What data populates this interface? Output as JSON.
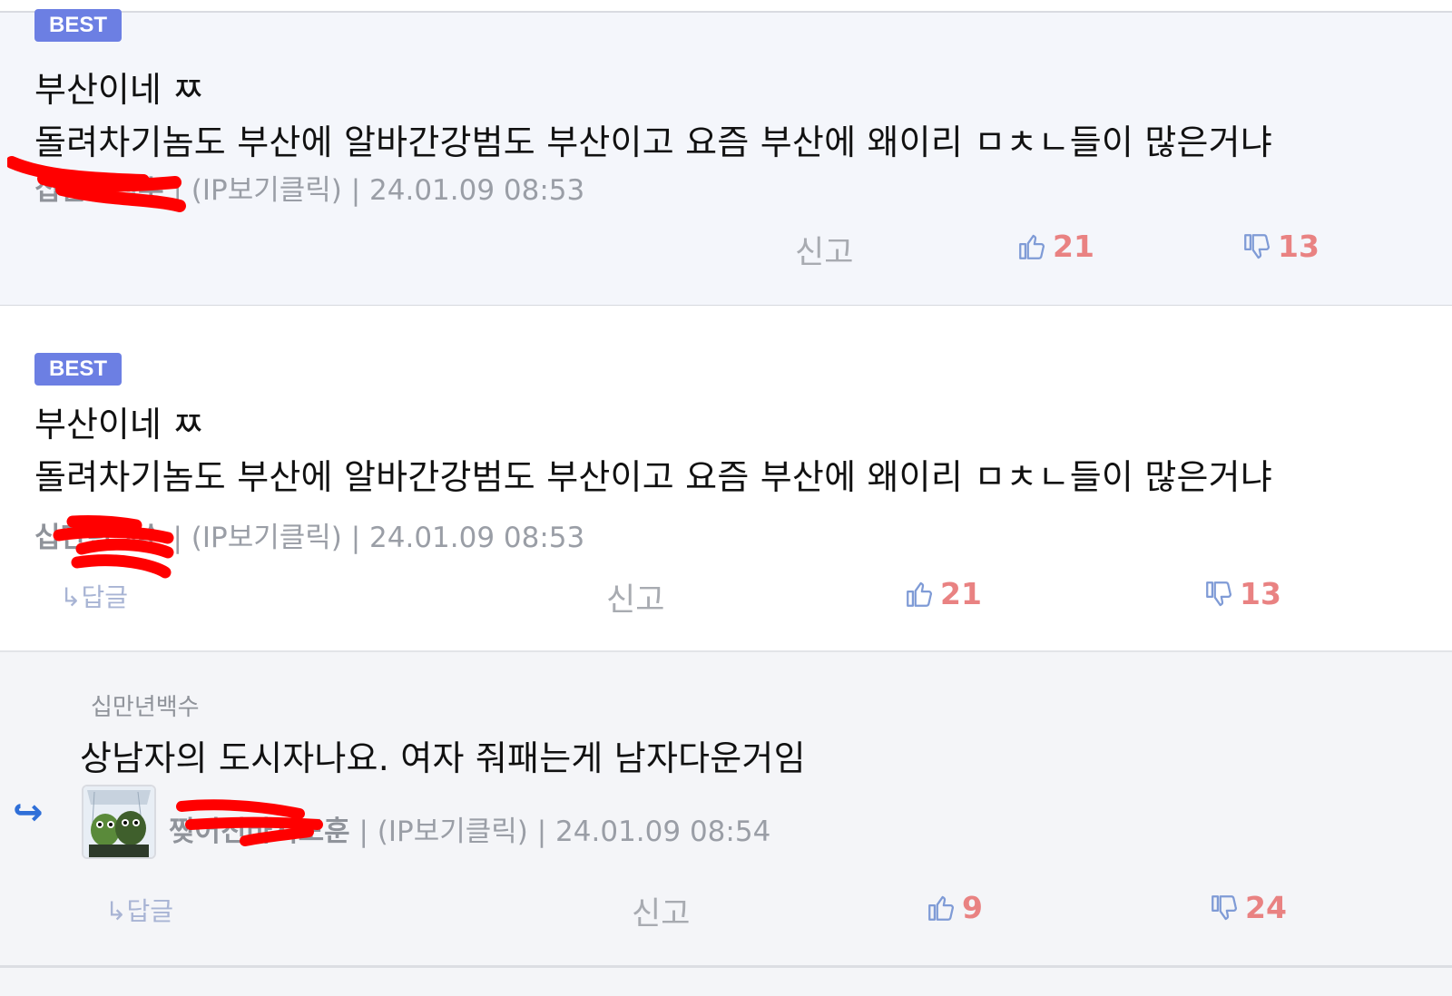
{
  "comments": [
    {
      "badge": "BEST",
      "title": "부산이네 ㅉ",
      "body": "돌려차기놈도 부산에 알바간강범도 부산이고 요즘 부산에 왜이리 ㅁㅊㄴ들이 많은거냐",
      "user": "십만년백수",
      "meta": " | (IP보기클릭) | 24.01.09 08:53",
      "report": "신고",
      "likes": "21",
      "dislikes": "13"
    },
    {
      "badge": "BEST",
      "title": "부산이네 ㅉ",
      "body": "돌려차기놈도 부산에 알바간강범도 부산이고 요즘 부산에 왜이리 ㅁㅊㄴ들이 많은거냐",
      "user": "십만년백수",
      "meta": " | (IP보기클릭) | 24.01.09 08:53",
      "reply": "↳답글",
      "report": "신고",
      "likes": "21",
      "dislikes": "13"
    }
  ],
  "reply_comment": {
    "reply_to": "십만년백수",
    "body": "상남자의 도시자나요. 여자 줘패는게 남자다운거임",
    "user": "찢어진바지도훈",
    "meta": " | (IP보기클릭) | 24.01.09 08:54",
    "reply": "↳답글",
    "report": "신고",
    "likes": "9",
    "dislikes": "24",
    "arrow": "↪"
  },
  "colors": {
    "badge": "#6c7fe3",
    "vote_count": "#e98282",
    "thumb_icon": "#7f9bd6",
    "reply_arrow": "#2f6fd8",
    "redaction": "#ff0000"
  },
  "icons": [
    "thumbs-up-icon",
    "thumbs-down-icon",
    "reply-arrow-icon"
  ]
}
